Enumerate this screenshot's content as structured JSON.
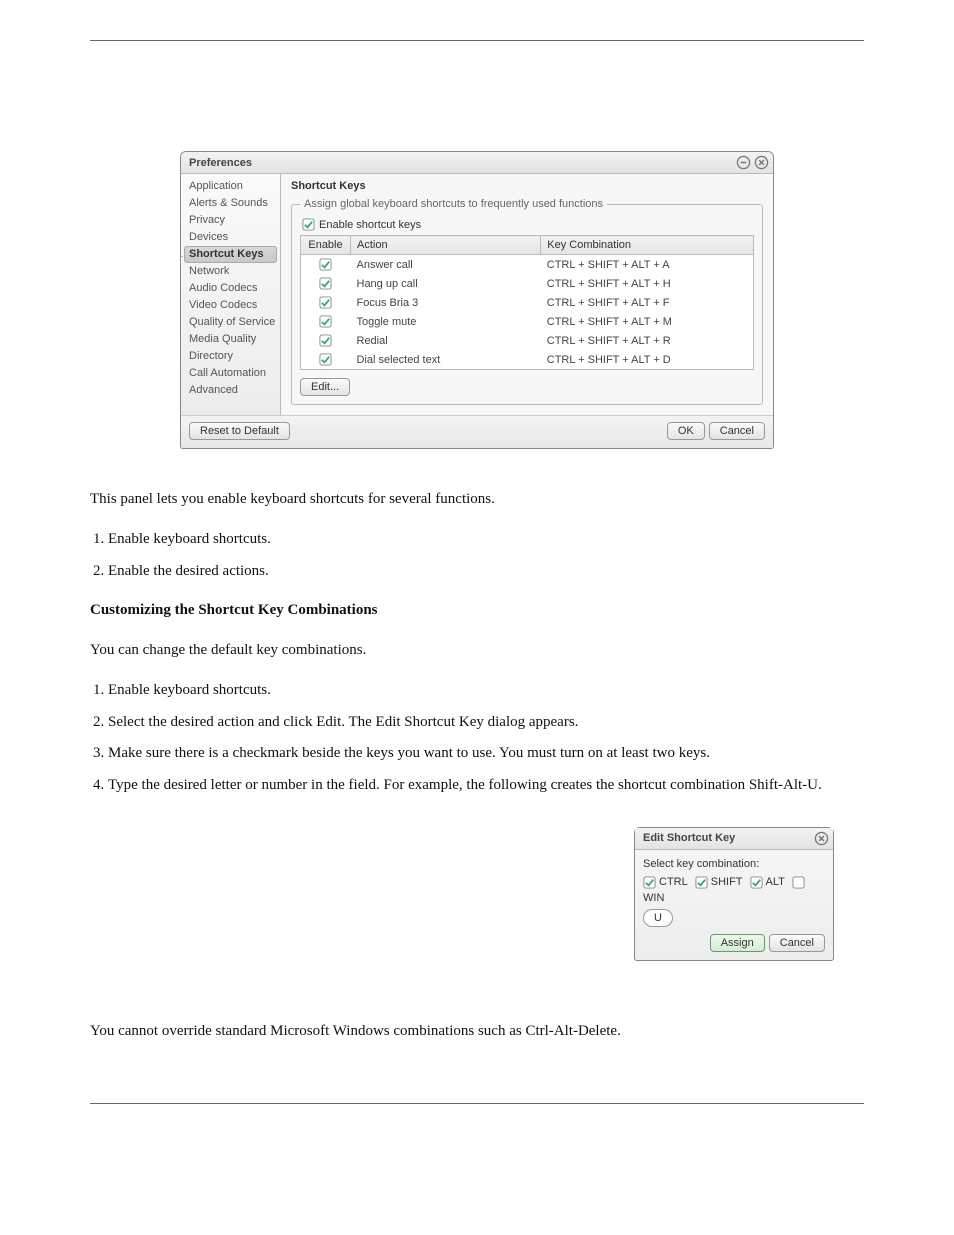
{
  "prefs_window": {
    "title": "Preferences",
    "sidebar": {
      "items": [
        "Application",
        "Alerts & Sounds",
        "Privacy",
        "Devices",
        "Shortcut Keys",
        "Network",
        "Audio Codecs",
        "Video Codecs",
        "Quality of Service",
        "Media Quality",
        "Directory",
        "Call Automation",
        "Advanced"
      ],
      "selected_index": 4
    },
    "content": {
      "heading": "Shortcut Keys",
      "group_legend": "Assign global keyboard shortcuts to frequently used functions",
      "enable_label": "Enable shortcut keys",
      "enable_checked": true,
      "columns": {
        "enable": "Enable",
        "action": "Action",
        "key_combo": "Key Combination"
      },
      "rows": [
        {
          "enabled": true,
          "action": "Answer call",
          "key": "CTRL + SHIFT + ALT + A"
        },
        {
          "enabled": true,
          "action": "Hang up call",
          "key": "CTRL + SHIFT + ALT + H"
        },
        {
          "enabled": true,
          "action": "Focus Bria 3",
          "key": "CTRL + SHIFT + ALT + F"
        },
        {
          "enabled": true,
          "action": "Toggle mute",
          "key": "CTRL + SHIFT + ALT + M"
        },
        {
          "enabled": true,
          "action": "Redial",
          "key": "CTRL + SHIFT + ALT + R"
        },
        {
          "enabled": true,
          "action": "Dial selected text",
          "key": "CTRL + SHIFT + ALT + D"
        }
      ],
      "edit_button": "Edit..."
    },
    "bottom": {
      "reset": "Reset to Default",
      "ok": "OK",
      "cancel": "Cancel"
    }
  },
  "body_text": {
    "intro": "This panel lets you enable keyboard shortcuts for several functions.",
    "step1": "Enable keyboard shortcuts.",
    "step2": "Enable the desired actions.",
    "customize_heading": "Customizing the Shortcut Key Combinations",
    "customize_body": "You can change the default key combinations.",
    "c1": "Enable keyboard shortcuts.",
    "c2": "Select the desired action and click Edit. The Edit Shortcut Key dialog appears.",
    "c3": "Make sure there is a checkmark beside the keys you want to use. You must turn on at least two keys.",
    "c4": "Type the desired letter or number in the field. For example, the following creates the shortcut combination Shift-Alt-U.",
    "footer": "You cannot override standard Microsoft Windows combinations such as Ctrl-Alt-Delete."
  },
  "edit_dialog": {
    "title": "Edit Shortcut Key",
    "select_label": "Select key combination:",
    "mods": [
      {
        "label": "CTRL",
        "checked": true
      },
      {
        "label": "SHIFT",
        "checked": true
      },
      {
        "label": "ALT",
        "checked": true
      },
      {
        "label": "WIN",
        "checked": false
      }
    ],
    "key_value": "U",
    "assign": "Assign",
    "cancel": "Cancel"
  }
}
